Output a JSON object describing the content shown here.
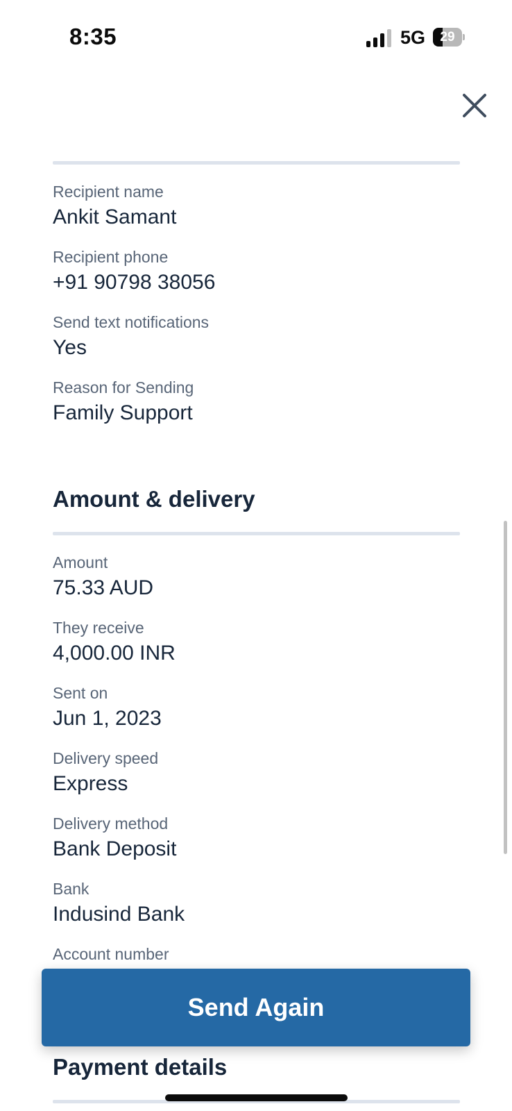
{
  "status_bar": {
    "time": "8:35",
    "network": "5G",
    "battery": "29"
  },
  "recipient": {
    "fields": [
      {
        "label": "Recipient name",
        "value": "Ankit Samant"
      },
      {
        "label": "Recipient phone",
        "value": "+91 90798 38056"
      },
      {
        "label": "Send text notifications",
        "value": "Yes"
      },
      {
        "label": "Reason for Sending",
        "value": "Family Support"
      }
    ]
  },
  "amount_delivery": {
    "title": "Amount & delivery",
    "fields": [
      {
        "label": "Amount",
        "value": "75.33 AUD"
      },
      {
        "label": "They receive",
        "value": "4,000.00 INR"
      },
      {
        "label": "Sent on",
        "value": "Jun 1, 2023"
      },
      {
        "label": "Delivery speed",
        "value": "Express"
      },
      {
        "label": "Delivery method",
        "value": "Bank Deposit"
      },
      {
        "label": "Bank",
        "value": "Indusind Bank"
      },
      {
        "label": "Account number",
        "value": ""
      }
    ]
  },
  "payment_details": {
    "title": "Payment details"
  },
  "actions": {
    "send_again_label": "Send Again"
  },
  "icons": {
    "close": "close-icon",
    "signal": "cellular-signal-icon",
    "battery": "battery-icon"
  }
}
